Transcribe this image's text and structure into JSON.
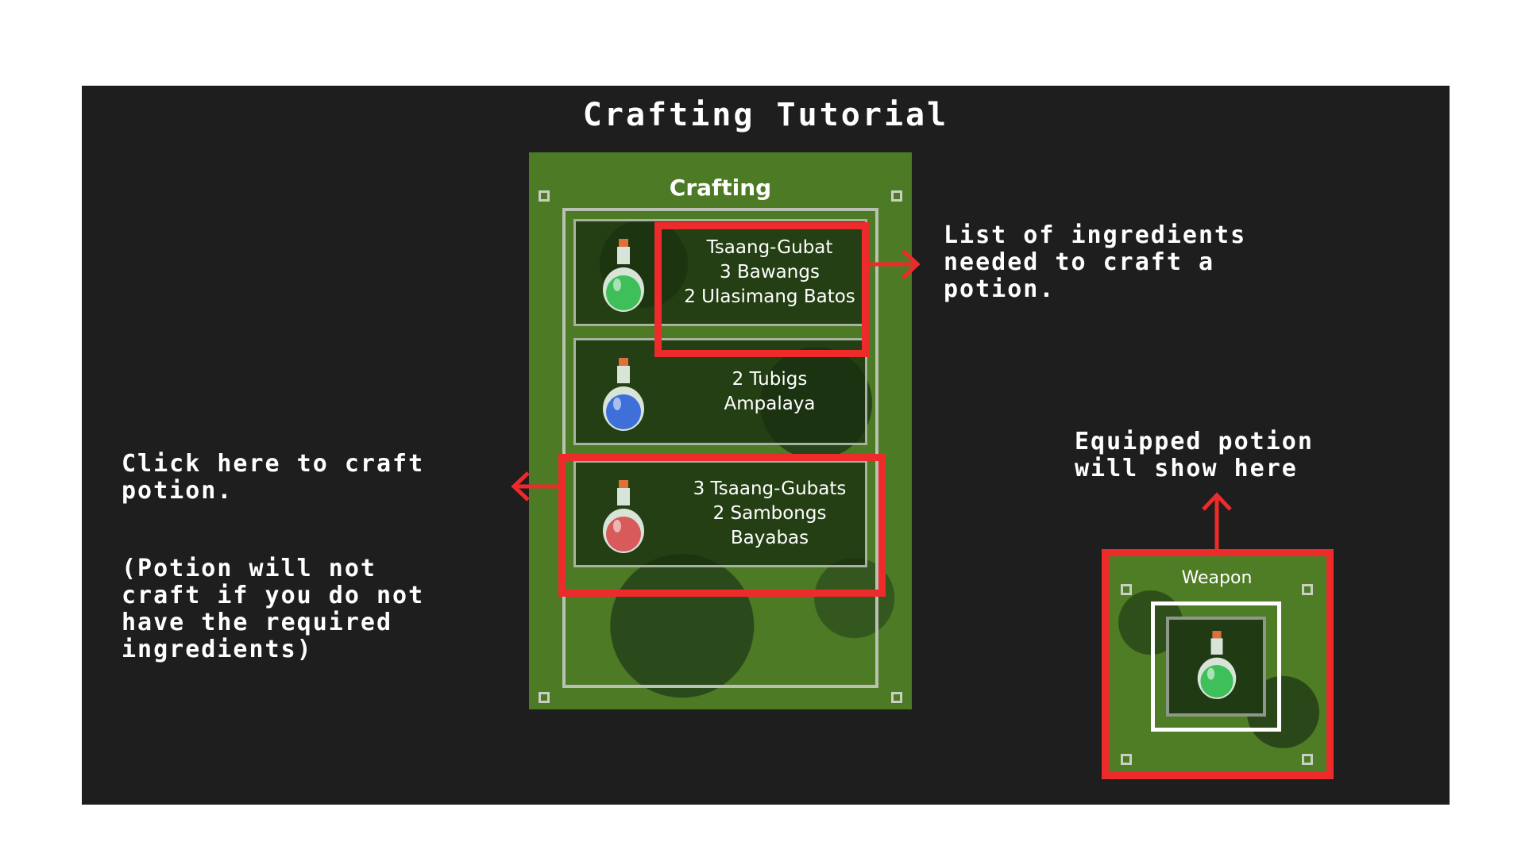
{
  "title": "Crafting Tutorial",
  "panel": {
    "title": "Crafting",
    "recipes": [
      {
        "lines": [
          "Tsaang-Gubat",
          "3 Bawangs",
          "2 Ulasimang Batos"
        ],
        "potion_color": "#3fbf5a",
        "potion_icon": "green-potion"
      },
      {
        "lines": [
          "2 Tubigs",
          "Ampalaya"
        ],
        "potion_color": "#3f6fd8",
        "potion_icon": "blue-potion"
      },
      {
        "lines": [
          "3 Tsaang-Gubats",
          "2 Sambongs",
          "Bayabas"
        ],
        "potion_color": "#d85a5a",
        "potion_icon": "red-potion"
      }
    ]
  },
  "annotations": {
    "ingredients": "List of ingredients\nneeded to craft a\npotion.",
    "craft": "Click here to craft\npotion.",
    "warning": "(Potion will not\ncraft if you do not\nhave the required\ningredients)",
    "equipped": "Equipped potion\nwill show here"
  },
  "equipped_slot": {
    "label": "Weapon",
    "potion_color": "#3fbf5a",
    "potion_icon": "green-potion"
  },
  "colors": {
    "highlight": "#ee2b2b",
    "background": "#1e1e1e",
    "panel_green": "#4d7a24"
  }
}
